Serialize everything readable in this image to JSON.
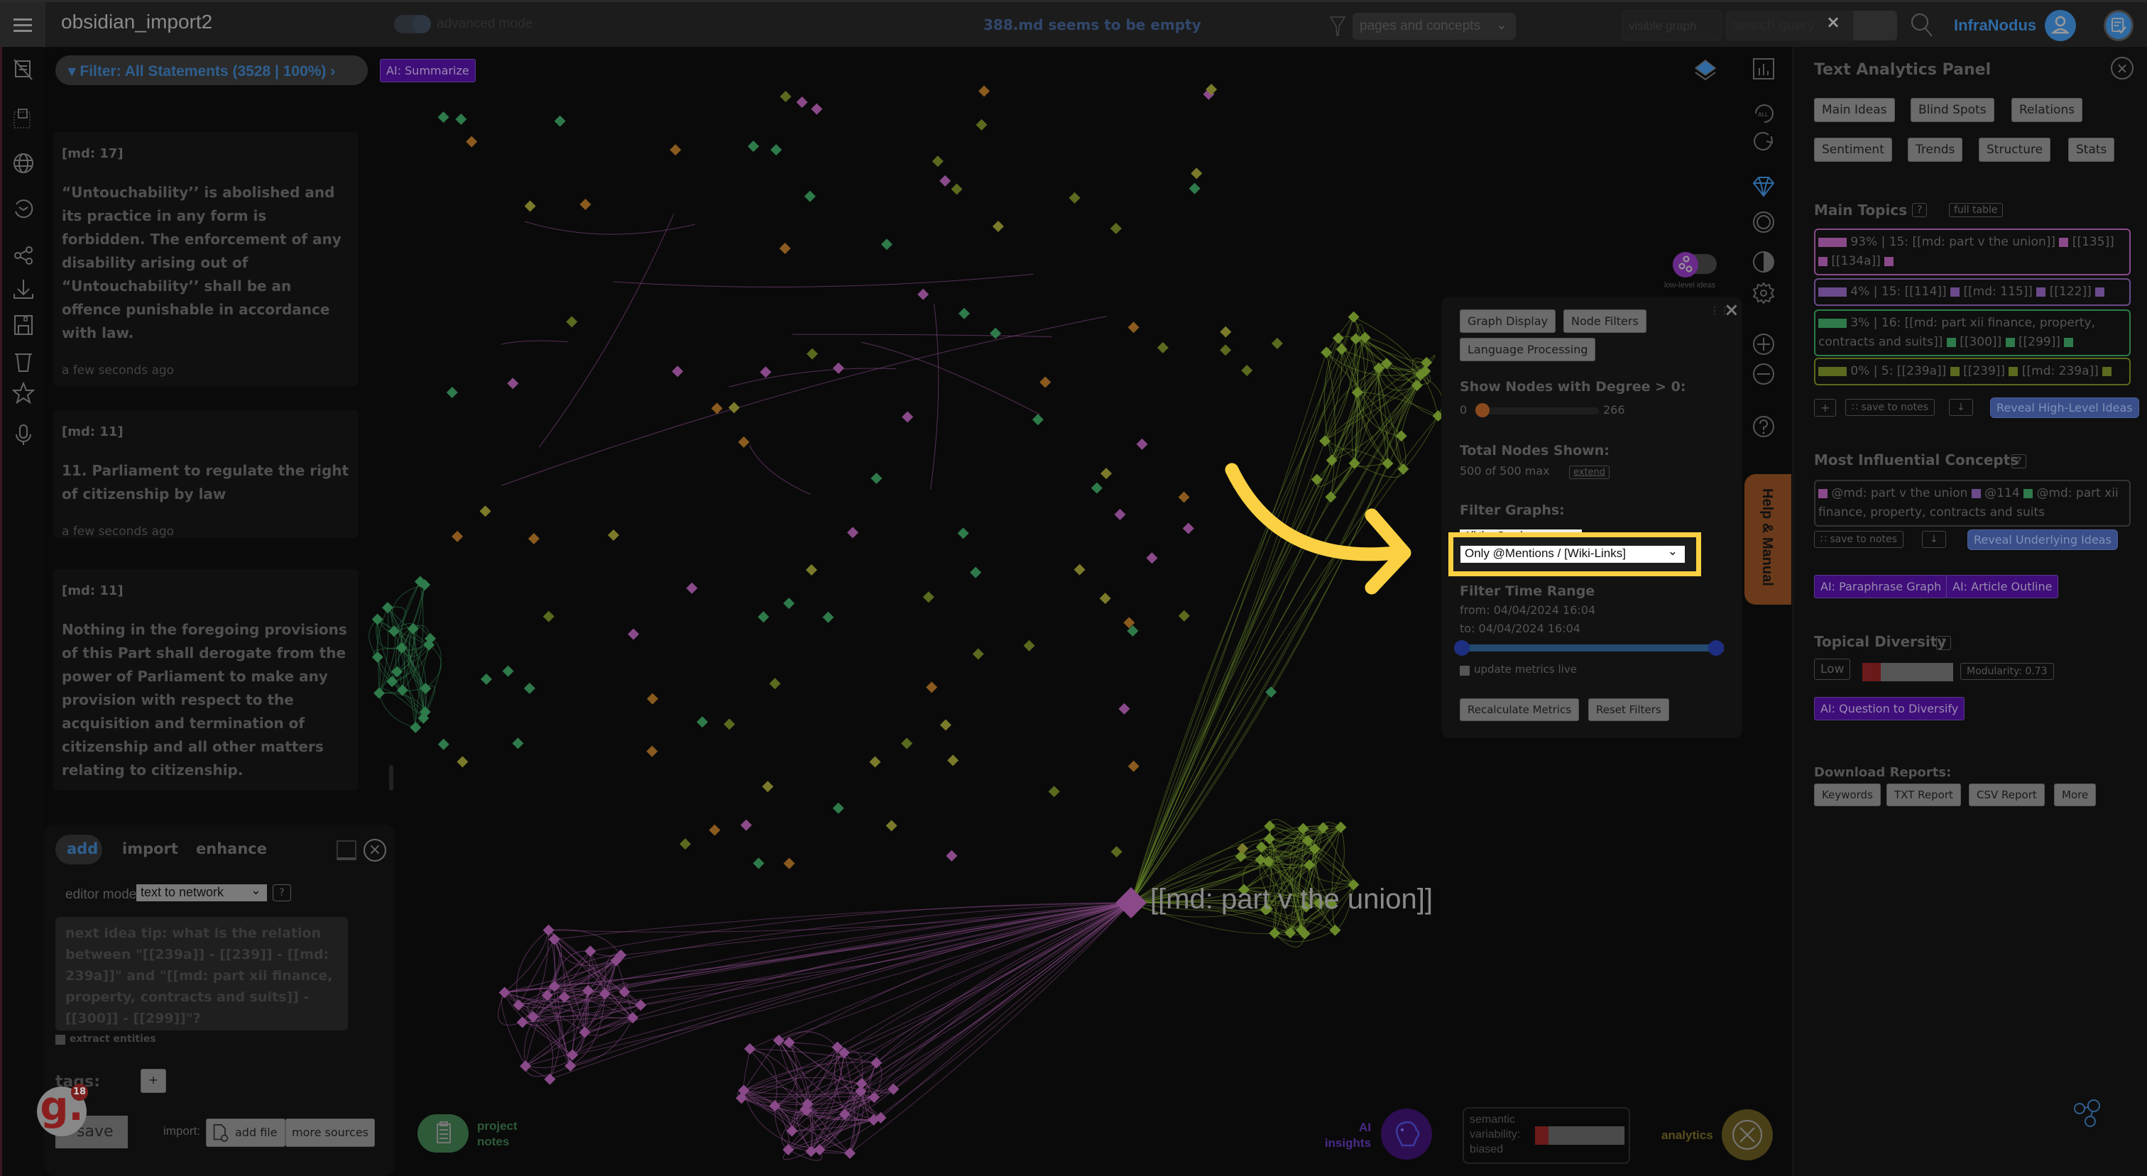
{
  "topbar": {
    "app_title": "obsidian_import2",
    "advanced_mode_label": "advanced mode",
    "status_message": "388.md seems to be empty",
    "pages_select": "pages and concepts",
    "visible_select": "visible graph",
    "search_placeholder": "search query",
    "search_clear": "×",
    "brand": "InfraNodus"
  },
  "graph_header": {
    "filter_label": "▾ Filter: All Statements (3528 | 100%) ›",
    "summarize_label": "AI: Summarize",
    "low_level_ideas_label": "low-level ideas",
    "focused_node_label": "[[md: part v the union]]"
  },
  "statements": [
    {
      "tag": "[md: 17]",
      "text": "“Untouchability’’ is abolished and its practice in any form is forbidden. The enforcement of any disability arising out of “Untouchability’’ shall be an offence punishable in accordance with law.",
      "time": "a few seconds ago"
    },
    {
      "tag": "[md: 11]",
      "text": "11. Parliament to regulate the right of citizenship by law",
      "time": "a few seconds ago"
    },
    {
      "tag": "[md: 11]",
      "text": "Nothing in the foregoing provisions of this Part shall derogate from the power of Parliament to make any provision with respect to the acquisition and termination of citizenship and all other matters relating to citizenship.",
      "time": ""
    }
  ],
  "editor": {
    "tabs": [
      "add",
      "import",
      "enhance"
    ],
    "editor_mode_label": "editor mode",
    "editor_mode_value": "text to network",
    "help": "?",
    "idea_placeholder": "next idea tip: what is the relation between \"[[239a]] - [[239]] - [[md: 239a]]\" and \"[[md: part xii finance, property, contracts and suits]] - [[300]] - [[299]]\"?",
    "extract_entities": "extract entities",
    "tags_label": "tags:",
    "tags_add": "+",
    "save": "save",
    "import_label": "import:",
    "add_file": "add file",
    "more_sources": "more sources",
    "notification_count": "18",
    "notification_letter": "g."
  },
  "settings_popup": {
    "tabs": [
      "Graph Display",
      "Node Filters",
      "Language Processing"
    ],
    "degree_heading": "Show Nodes with Degree > 0:",
    "degree_min": "0",
    "degree_max": "266",
    "degree_value": 0,
    "total_heading": "Total Nodes Shown:",
    "total_value": "500 of 500 max",
    "extend": "extend",
    "filter_graphs_heading": "Filter Graphs:",
    "filter_graphs_option_1": "All the Graphs",
    "filter_graphs_option_2": "Only @Mentions / [Wiki-Links]",
    "time_heading": "Filter Time Range",
    "time_from": "from: 04/04/2024 16:04",
    "time_to": "to: 04/04/2024 16:04",
    "update_live": "update metrics live",
    "recalculate": "Recalculate Metrics",
    "reset": "Reset Filters",
    "close": "×"
  },
  "help_tab": "Help & Manual",
  "panel": {
    "title": "Text Analytics Panel",
    "tabs": [
      "Main Ideas",
      "Blind Spots",
      "Relations",
      "Sentiment",
      "Trends",
      "Structure",
      "Stats"
    ],
    "main_topics": {
      "heading": "Main Topics",
      "help": "?",
      "full_table": "full table",
      "topics": [
        {
          "percent": "93%",
          "id": "15",
          "terms": [
            "[[md: part v the union]]",
            "[[135]]",
            "[[134a]]"
          ],
          "color": "#8a4a8a"
        },
        {
          "percent": "4%",
          "id": "15",
          "terms": [
            "[[114]]",
            "[[md: 115]]",
            "[[122]]"
          ],
          "color": "#6a4a8a"
        },
        {
          "percent": "3%",
          "id": "16",
          "terms": [
            "[[md: part xii finance, property, contracts and suits]]",
            "[[300]]",
            "[[299]]"
          ],
          "color": "#2e7a4a"
        },
        {
          "percent": "0%",
          "id": "5",
          "terms": [
            "[[239a]]",
            "[[239]]",
            "[[md: 239a]]"
          ],
          "color": "#5a6a1e"
        }
      ],
      "plus": "+",
      "save_to_notes": "save to notes",
      "download": "↓",
      "reveal": "Reveal High-Level Ideas"
    },
    "influential": {
      "heading": "Most Influential Concepts",
      "help": "?",
      "concepts": [
        {
          "label": "@md: part v the union",
          "color": "#8a4a8a"
        },
        {
          "label": "@114",
          "color": "#6a4a8a"
        },
        {
          "label": "@md: part xii finance, property, contracts and suits",
          "color": "#2e7a4a"
        }
      ],
      "save_to_notes": "save to notes",
      "download": "↓",
      "reveal": "Reveal Underlying Ideas",
      "ai_paraphrase": "AI: Paraphrase Graph",
      "ai_outline": "AI: Article Outline"
    },
    "diversity": {
      "heading": "Topical Diversity",
      "help": "?",
      "level": "Low",
      "level_fraction": 0.2,
      "modularity": "Modularity: 0.73",
      "ai_question": "AI: Question to Diversify"
    },
    "reports": {
      "heading": "Download Reports:",
      "buttons": [
        "Keywords",
        "TXT Report",
        "CSV Report",
        "More"
      ]
    }
  },
  "bottom": {
    "project_notes": "project notes",
    "ai_insights": "AI insights",
    "semantic_variability": "semantic variability: biased",
    "variability_fraction": 0.15,
    "analytics": "analytics"
  },
  "colors": {
    "accent_blue": "#2f6aa3",
    "ai_purple": "#3f0e7a",
    "highlight_yellow": "#fbd143",
    "topic_pink": "#8a4a8a",
    "topic_green": "#2e7a4a",
    "topic_olive": "#5a6a1e"
  }
}
